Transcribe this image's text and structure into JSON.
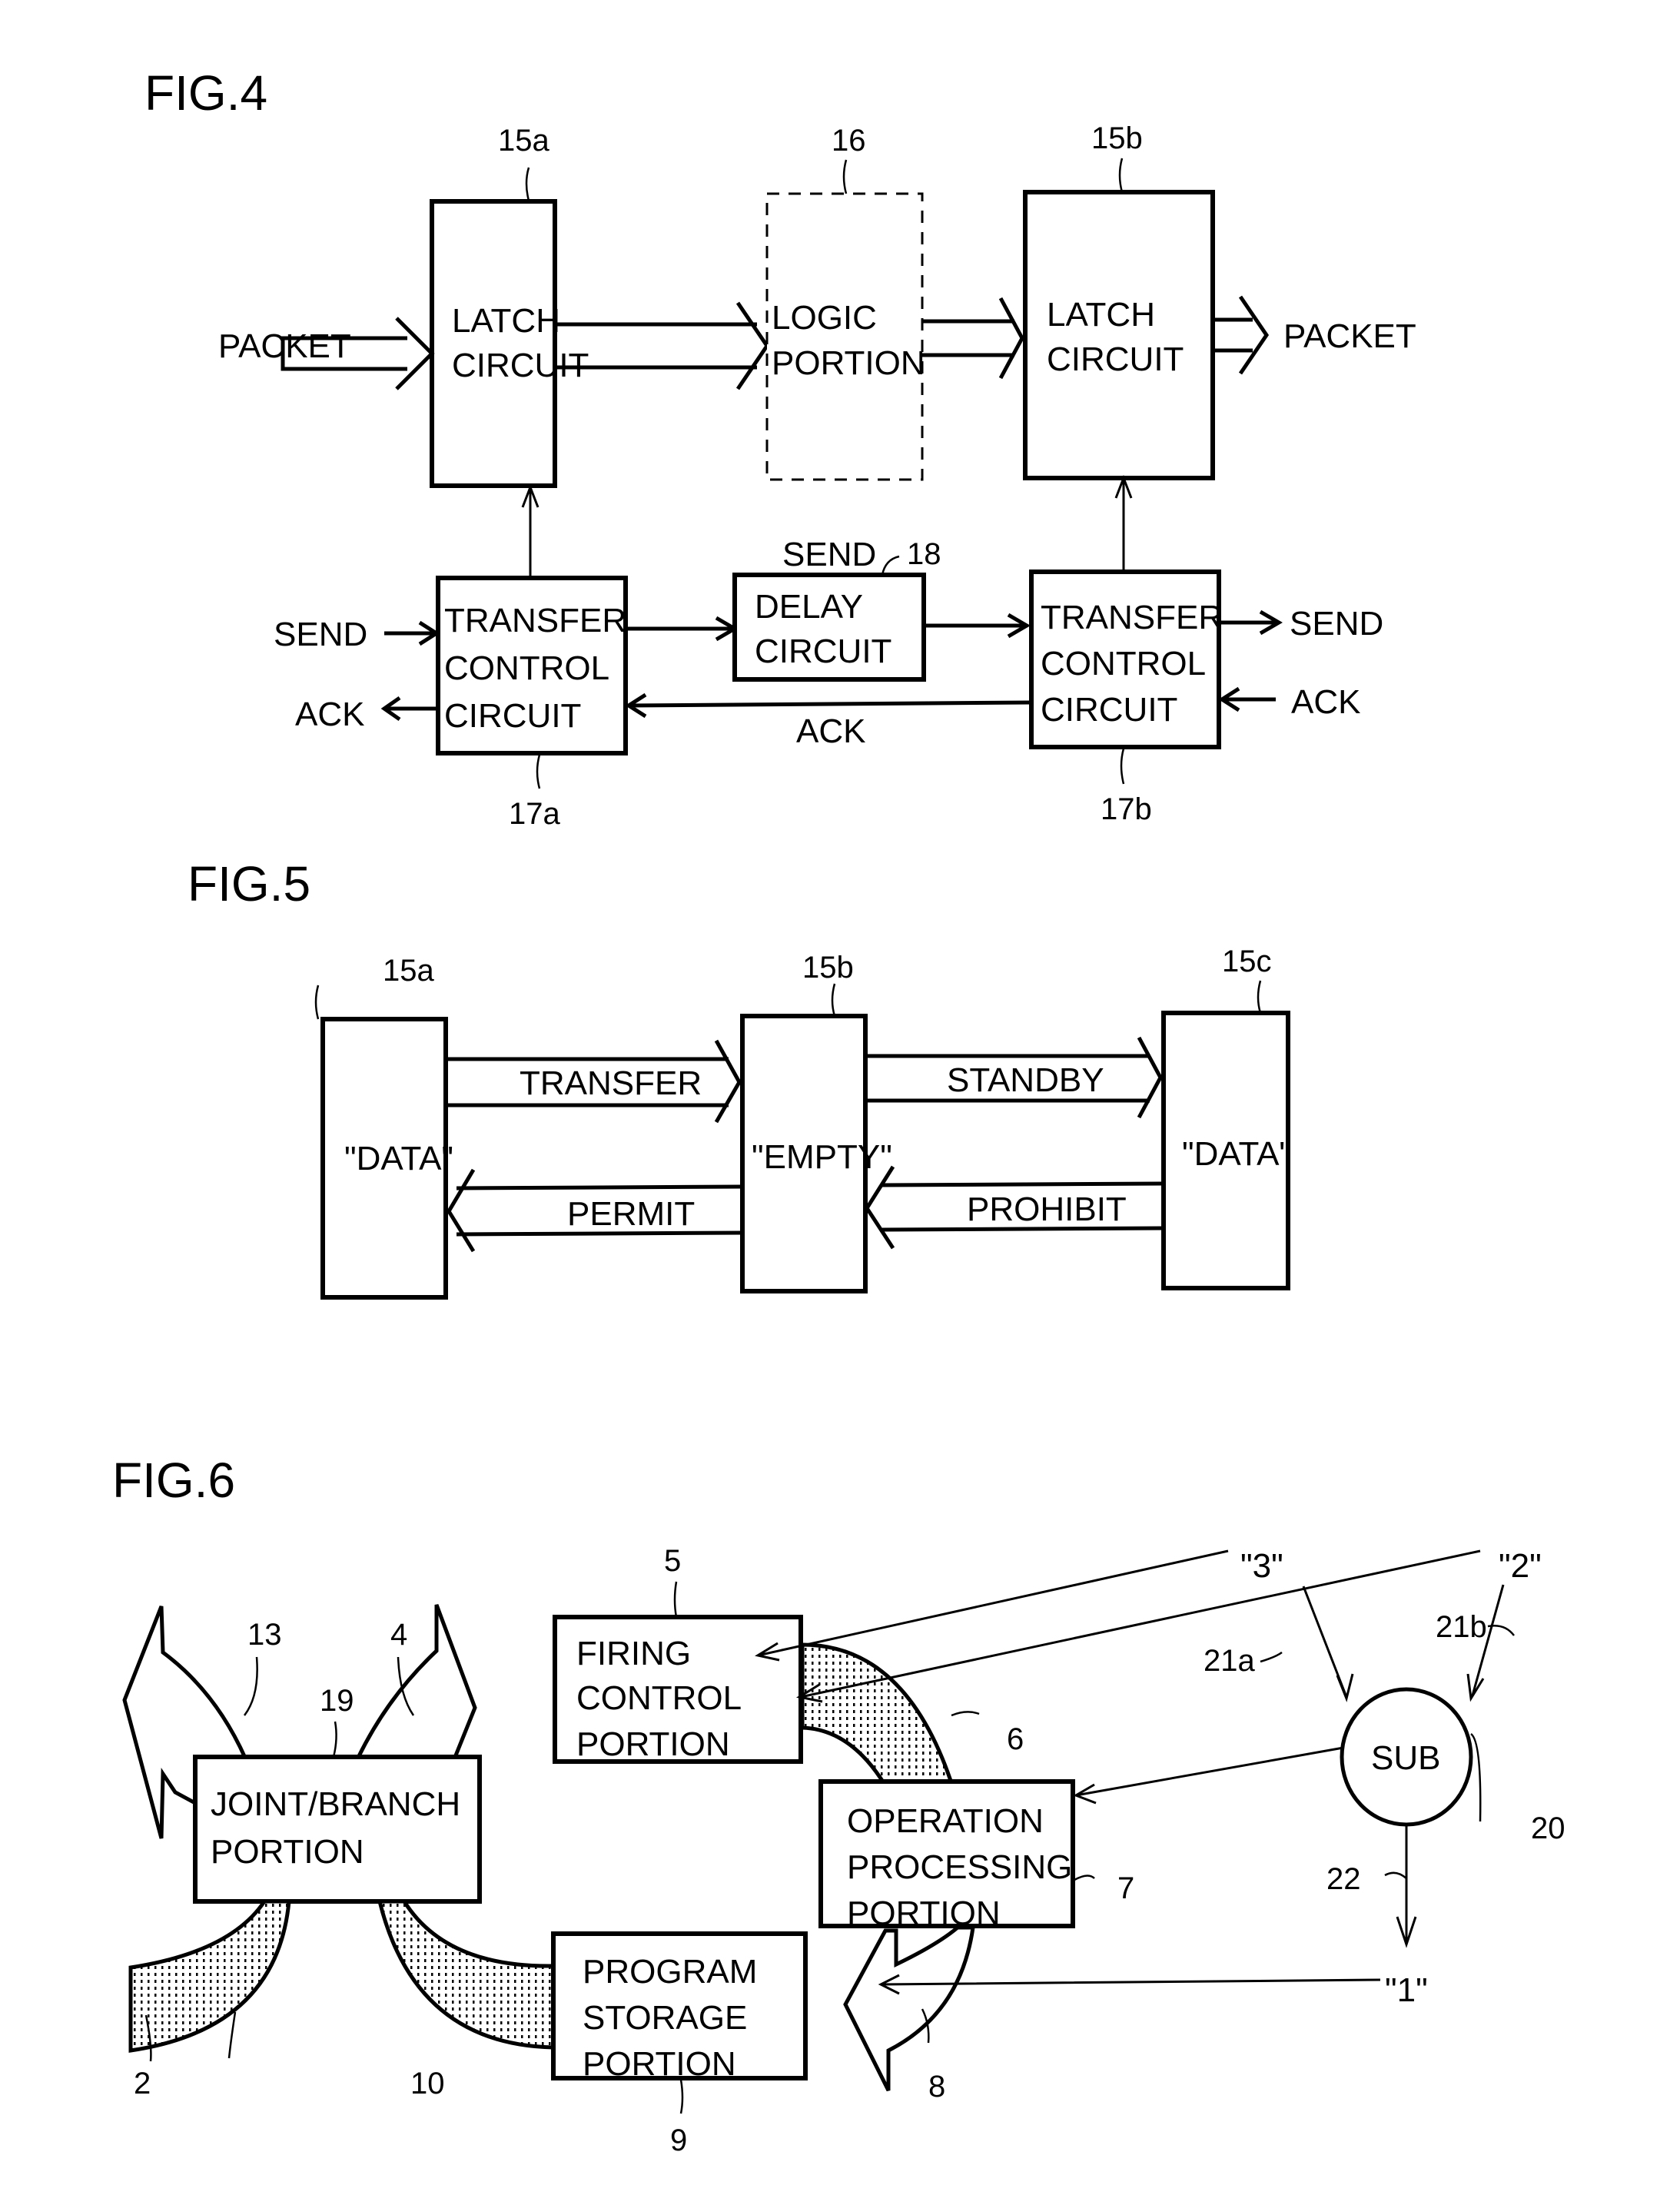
{
  "fig4": {
    "title": "FIG.4",
    "refs": {
      "latch_a": "15a",
      "logic": "16",
      "latch_b": "15b",
      "delay": "18",
      "tcc_a": "17a",
      "tcc_b": "17b"
    },
    "latch_a": {
      "line1": "LATCH",
      "line2": "CIRCUIT"
    },
    "logic": {
      "line1": "LOGIC",
      "line2": "PORTION"
    },
    "latch_b": {
      "line1": "LATCH",
      "line2": "CIRCUIT"
    },
    "packet_in": "PACKET",
    "packet_out": "PACKET",
    "tcc_a": {
      "line1": "TRANSFER",
      "line2": "CONTROL",
      "line3": "CIRCUIT"
    },
    "tcc_b": {
      "line1": "TRANSFER",
      "line2": "CONTROL",
      "line3": "CIRCUIT"
    },
    "delay": {
      "line1": "DELAY",
      "line2": "CIRCUIT"
    },
    "send_in": "SEND",
    "ack_out": "ACK",
    "send_mid": "SEND",
    "ack_mid": "ACK",
    "send_out": "SEND",
    "ack_in": "ACK"
  },
  "fig5": {
    "title": "FIG.5",
    "refs": {
      "a": "15a",
      "b": "15b",
      "c": "15c"
    },
    "box_a": "\"DATA\"",
    "box_b": "\"EMPTY\"",
    "box_c": "\"DATA\"",
    "transfer": "TRANSFER",
    "standby": "STANDBY",
    "permit": "PERMIT",
    "prohibit": "PROHIBIT"
  },
  "fig6": {
    "title": "FIG.6",
    "refs": {
      "firing": "5",
      "arc13": "13",
      "arc4": "4",
      "joint": "19",
      "arc6": "6",
      "op": "7",
      "sub": "20",
      "arc8": "8",
      "storage": "9",
      "arc10": "10",
      "arc2": "2",
      "line21a": "21a",
      "line21b": "21b",
      "line22": "22"
    },
    "firing": {
      "line1": "FIRING",
      "line2": "CONTROL",
      "line3": "PORTION"
    },
    "joint": {
      "line1": "JOINT/BRANCH",
      "line2": "PORTION"
    },
    "op": {
      "line1": "OPERATION",
      "line2": "PROCESSING",
      "line3": "PORTION"
    },
    "storage": {
      "line1": "PROGRAM",
      "line2": "STORAGE",
      "line3": "PORTION"
    },
    "sub": "SUB",
    "val3": "\"3\"",
    "val2": "\"2\"",
    "val1": "\"1\""
  }
}
